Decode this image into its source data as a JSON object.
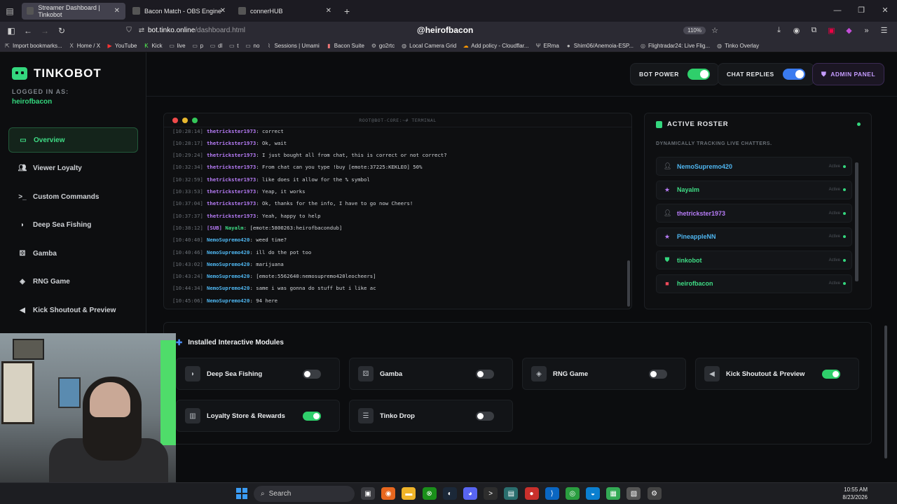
{
  "browser": {
    "tabs": [
      {
        "title": "Streamer Dashboard | Tinkobot",
        "active": true
      },
      {
        "title": "Bacon Match - OBS Engine",
        "active": false
      },
      {
        "title": "connerHUB",
        "active": false
      }
    ],
    "url_domain": "bot.tinko.online",
    "url_path": "/dashboard.html",
    "center_title": "@heirofbacon",
    "zoom": "110%",
    "bookmarks": [
      "Import bookmarks...",
      "Home / X",
      "YouTube",
      "Kick",
      "live",
      "p",
      "dl",
      "t",
      "no",
      "Sessions | Umami",
      "Bacon Suite",
      "go2rtc",
      "Local Camera Grid",
      "Add policy - Cloudflar...",
      "ERma",
      "Shim06/Anemoia-ESP...",
      "Flightradar24: Live Flig...",
      "Tinko Overlay"
    ]
  },
  "sidebar": {
    "brand": "TINKOBOT",
    "logged_label": "LOGGED IN AS:",
    "username": "heirofbacon",
    "items": [
      {
        "label": "Overview",
        "icon": "monitor-icon",
        "active": true
      },
      {
        "label": "Viewer Loyalty",
        "icon": "users-icon",
        "active": false
      },
      {
        "label": "Custom Commands",
        "icon": "terminal-icon",
        "active": false
      },
      {
        "label": "Deep Sea Fishing",
        "icon": "fish-icon",
        "active": false
      },
      {
        "label": "Gamba",
        "icon": "dice-icon",
        "active": false
      },
      {
        "label": "RNG Game",
        "icon": "gamepad-icon",
        "active": false
      },
      {
        "label": "Kick Shoutout & Preview",
        "icon": "megaphone-icon",
        "active": false
      }
    ]
  },
  "topbar": {
    "bot_power_label": "BOT POWER",
    "bot_power_on": true,
    "chat_replies_label": "CHAT REPLIES",
    "chat_replies_on": true,
    "admin_label": "ADMIN PANEL"
  },
  "terminal": {
    "title": "ROOT@BOT-CORE:~# TERMINAL",
    "lines": [
      {
        "ts": "[10:28:14]",
        "user": "thetrickster1973",
        "msg": "correct",
        "color": "#b77cf7"
      },
      {
        "ts": "[10:28:17]",
        "user": "thetrickster1973",
        "msg": "Ok, wait",
        "color": "#b77cf7"
      },
      {
        "ts": "[10:29:24]",
        "user": "thetrickster1973",
        "msg": "I just bought all from chat, this is correct or not correct?",
        "color": "#b77cf7"
      },
      {
        "ts": "[10:32:34]",
        "user": "thetrickster1973",
        "msg": "From chat can you type !buy [emote:37225:KEKLEO] 50%",
        "color": "#b77cf7"
      },
      {
        "ts": "[10:32:59]",
        "user": "thetrickster1973",
        "msg": "like does it allow for the % symbol",
        "color": "#b77cf7"
      },
      {
        "ts": "[10:33:53]",
        "user": "thetrickster1973",
        "msg": "Yeap, it works",
        "color": "#b77cf7"
      },
      {
        "ts": "[10:37:04]",
        "user": "thetrickster1973",
        "msg": "Ok, thanks for the info, I have to go now Cheers!",
        "color": "#b77cf7"
      },
      {
        "ts": "[10:37:37]",
        "user": "thetrickster1973",
        "msg": "Yeah, happy to help",
        "color": "#b77cf7"
      },
      {
        "ts": "[10:38:12]",
        "sub": "[SUB]",
        "user": "Nayalm",
        "msg": "[emote:5800263:heirofbacondub]",
        "color": "#3fdc85"
      },
      {
        "ts": "[10:40:40]",
        "user": "NemoSupremo420",
        "msg": "weed time?",
        "color": "#4fb6f0"
      },
      {
        "ts": "[10:40:46]",
        "user": "NemoSupremo420",
        "msg": "ill do the pot too",
        "color": "#4fb6f0"
      },
      {
        "ts": "[10:43:02]",
        "user": "NemoSupremo420",
        "msg": "marijuana",
        "color": "#4fb6f0"
      },
      {
        "ts": "[10:43:24]",
        "user": "NemoSupremo420",
        "msg": "[emote:5562640:nemosupremo420leocheers]",
        "color": "#4fb6f0"
      },
      {
        "ts": "[10:44:34]",
        "user": "NemoSupremo420",
        "msg": "same i was gonna do stuff but i like ac",
        "color": "#4fb6f0"
      },
      {
        "ts": "[10:45:06]",
        "user": "NemoSupremo420",
        "msg": "94 here",
        "color": "#4fb6f0"
      }
    ]
  },
  "roster": {
    "title": "ACTIVE ROSTER",
    "subtitle": "DYNAMICALLY TRACKING LIVE CHATTERS.",
    "users": [
      {
        "name": "NemoSupremo420",
        "status": "Active",
        "color": "#4fb6f0",
        "icon": "user-icon",
        "icon_color": "#8a8f96"
      },
      {
        "name": "Nayalm",
        "status": "Active",
        "color": "#3fdc85",
        "icon": "star-icon",
        "icon_color": "#b77cf7"
      },
      {
        "name": "thetrickster1973",
        "status": "Active",
        "color": "#b77cf7",
        "icon": "user-icon",
        "icon_color": "#8a8f96"
      },
      {
        "name": "PineappleNN",
        "status": "Active",
        "color": "#4fb6f0",
        "icon": "star-icon",
        "icon_color": "#b77cf7"
      },
      {
        "name": "tinkobot",
        "status": "Active",
        "color": "#3fdc85",
        "icon": "shield-icon",
        "icon_color": "#34d77e"
      },
      {
        "name": "heirofbacon",
        "status": "Active",
        "color": "#3fdc85",
        "icon": "video-icon",
        "icon_color": "#ef4a5a"
      }
    ]
  },
  "modules": {
    "title": "Installed Interactive Modules",
    "items": [
      {
        "name": "Deep Sea Fishing",
        "on": false,
        "icon": "fish-icon"
      },
      {
        "name": "Gamba",
        "on": false,
        "icon": "dice-icon"
      },
      {
        "name": "RNG Game",
        "on": false,
        "icon": "gamepad-icon"
      },
      {
        "name": "Kick Shoutout & Preview",
        "on": true,
        "icon": "megaphone-icon"
      },
      {
        "name": "Loyalty Store & Rewards",
        "on": true,
        "icon": "store-icon"
      },
      {
        "name": "Tinko Drop",
        "on": false,
        "icon": "layers-icon"
      }
    ]
  },
  "taskbar": {
    "search": "Search",
    "time": "10:55 AM",
    "date": "8/23/2026"
  }
}
